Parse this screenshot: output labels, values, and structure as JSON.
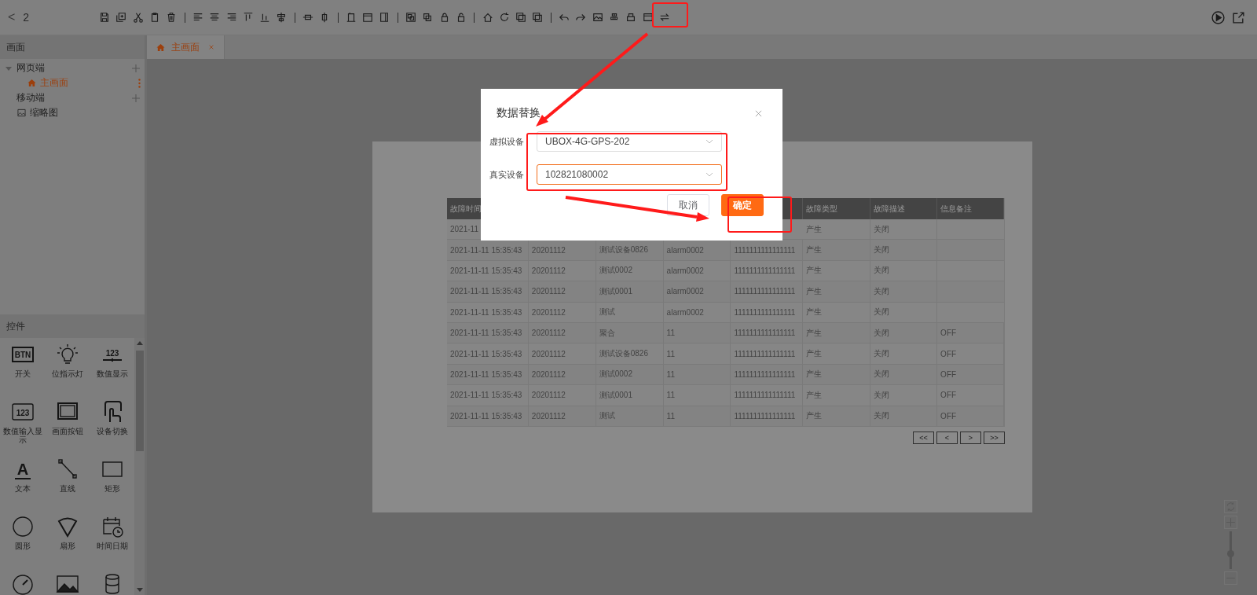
{
  "toolbar": {
    "back": "<",
    "page_number": "2"
  },
  "sidebar": {
    "header": "画面",
    "tree": [
      {
        "kind": "group",
        "label": "网页端",
        "children": [
          {
            "label": "主画面",
            "selected": true
          }
        ]
      },
      {
        "kind": "group",
        "label": "移动端"
      },
      {
        "kind": "thumbnail",
        "label": "缩略图"
      }
    ]
  },
  "controls": {
    "header": "控件",
    "items": [
      {
        "kind": "button",
        "icon_text": "BTN",
        "label": "开关"
      },
      {
        "kind": "bulb",
        "label": "位指示灯"
      },
      {
        "kind": "number",
        "icon_text": "123",
        "label": "数值显示"
      },
      {
        "kind": "number-input",
        "icon_text": "123",
        "label": "数值输入显示"
      },
      {
        "kind": "frame",
        "label": "画面按钮"
      },
      {
        "kind": "touch",
        "label": "设备切换"
      },
      {
        "kind": "text",
        "icon_text": "A",
        "label": "文本"
      },
      {
        "kind": "line",
        "label": "直线"
      },
      {
        "kind": "rect",
        "label": "矩形"
      },
      {
        "kind": "circle",
        "label": "圆形"
      },
      {
        "kind": "fan",
        "label": "扇形"
      },
      {
        "kind": "datetime",
        "label": "时间日期"
      },
      {
        "kind": "gauge"
      },
      {
        "kind": "picture"
      },
      {
        "kind": "cylinder"
      }
    ]
  },
  "tabs": [
    {
      "label": "主画面",
      "selected": true
    }
  ],
  "table": {
    "columns": [
      "故障时间",
      null,
      null,
      null,
      null,
      "故障类型",
      "故障描述",
      "信息备注"
    ],
    "rows": [
      [
        "2021-11",
        null,
        null,
        null,
        null,
        "产生",
        "关闭",
        null
      ],
      [
        "2021-11-11 15:35:43",
        "20201112",
        "测试设备0826",
        "alarm0002",
        "1111111111111111",
        "产生",
        "关闭",
        null
      ],
      [
        "2021-11-11 15:35:43",
        "20201112",
        "测试0002",
        "alarm0002",
        "1111111111111111",
        "产生",
        "关闭",
        null
      ],
      [
        "2021-11-11 15:35:43",
        "20201112",
        "测试0001",
        "alarm0002",
        "1111111111111111",
        "产生",
        "关闭",
        null
      ],
      [
        "2021-11-11 15:35:43",
        "20201112",
        "测试",
        "alarm0002",
        "1111111111111111",
        "产生",
        "关闭",
        null
      ],
      [
        "2021-11-11 15:35:43",
        "20201112",
        "聚合",
        "11",
        "1111111111111111",
        "产生",
        "关闭",
        "OFF"
      ],
      [
        "2021-11-11 15:35:43",
        "20201112",
        "测试设备0826",
        "11",
        "1111111111111111",
        "产生",
        "关闭",
        "OFF"
      ],
      [
        "2021-11-11 15:35:43",
        "20201112",
        "测试0002",
        "11",
        "1111111111111111",
        "产生",
        "关闭",
        "OFF"
      ],
      [
        "2021-11-11 15:35:43",
        "20201112",
        "测试0001",
        "11",
        "1111111111111111",
        "产生",
        "关闭",
        "OFF"
      ],
      [
        "2021-11-11 15:35:43",
        "20201112",
        "测试",
        "11",
        "1111111111111111",
        "产生",
        "关闭",
        "OFF"
      ]
    ],
    "pagination": [
      "<<",
      "<",
      ">",
      ">>"
    ]
  },
  "zoom": {
    "level": 0.4
  },
  "dialog": {
    "title": "数据替换",
    "fields": [
      {
        "label": "虚拟设备",
        "value": "UBOX-4G-GPS-202",
        "focused": false
      },
      {
        "label": "真实设备",
        "value": "102821080002",
        "focused": true
      }
    ],
    "buttons": [
      {
        "label": "取消",
        "kind": "secondary"
      },
      {
        "label": "确定",
        "kind": "primary"
      }
    ]
  }
}
